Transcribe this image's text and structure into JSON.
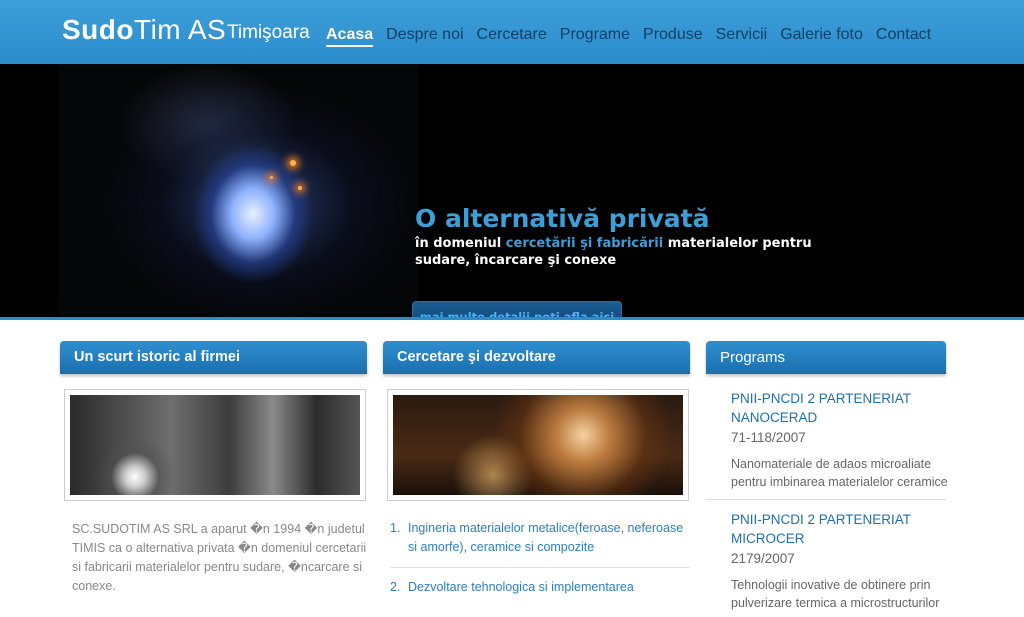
{
  "header": {
    "logo_bold": "Sudo",
    "logo_rest": "Tim AS",
    "city": "Timişoara",
    "nav": [
      {
        "label": "Acasa",
        "active": true
      },
      {
        "label": "Despre noi"
      },
      {
        "label": "Cercetare"
      },
      {
        "label": "Programe"
      },
      {
        "label": "Produse"
      },
      {
        "label": "Servicii"
      },
      {
        "label": "Galerie foto"
      },
      {
        "label": "Contact"
      }
    ]
  },
  "hero": {
    "title": "O alternativă privată",
    "sub_part1": "în domeniul ",
    "sub_highlight": "cercetării şi fabricării",
    "sub_part2": " materialelor pentru sudare, încarcare şi conexe",
    "button": "mai multe detalii poţi afla aici"
  },
  "columns": {
    "history": {
      "heading": "Un scurt istoric al firmei",
      "text": "SC.SUDOTIM AS SRL a aparut �n 1994 �n judetul TIMIS ca o alternativa privata �n domeniul cercetarii si fabricarii materialelor pentru sudare, �ncarcare si conexe."
    },
    "research": {
      "heading": "Cercetare şi dezvoltare",
      "items": [
        {
          "num": "1.",
          "text": "Ingineria materialelor metalice(feroase, neferoase si amorfe), ceramice si compozite"
        },
        {
          "num": "2.",
          "text": "Dezvoltare tehnologica si implementarea"
        }
      ]
    },
    "programs": {
      "heading": "Programs",
      "items": [
        {
          "title": "PNII-PNCDI 2 PARTENERIAT NANOCERAD",
          "num": "71-118/2007",
          "desc": "Nanomateriale de adaos microaliate pentru imbinarea materialelor ceramice"
        },
        {
          "title": "PNII-PNCDI 2 PARTENERIAT MICROCER",
          "num": "2179/2007",
          "desc": "Tehnologii inovative de obtinere prin pulverizare termica a microstructurilor"
        }
      ]
    }
  },
  "colors": {
    "header_blue": "#2b8ccc",
    "nav_text": "#0f3f66",
    "accent_blue": "#3d9fd8",
    "link_blue": "#2a7fc2"
  }
}
